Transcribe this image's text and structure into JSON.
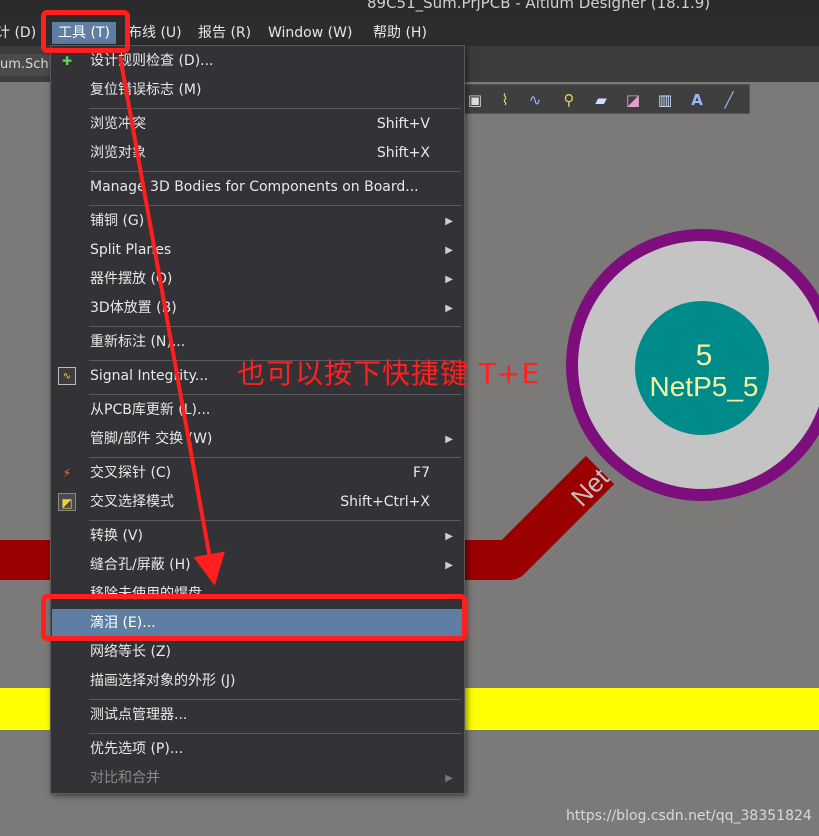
{
  "title_bar": {
    "title": "89C51_Sum.PrjPCB - Altium Designer (18.1.9)"
  },
  "menubar": {
    "items": [
      {
        "label": "计 (D)"
      },
      {
        "label": "工具 (T)"
      },
      {
        "label": "布线 (U)"
      },
      {
        "label": "报告 (R)"
      },
      {
        "label": "Window (W)"
      },
      {
        "label": "帮助 (H)"
      }
    ]
  },
  "doc_tab": {
    "label": "um.SchD"
  },
  "pad": {
    "number": "5",
    "net": "NetP5_5"
  },
  "trace_label": "Net",
  "annotation": {
    "text": "也可以按下快捷键 T+E"
  },
  "watermark": "https://blog.csdn.net/qq_38351824",
  "tools_menu": {
    "items": [
      {
        "label": "设计规则检查 (D)...",
        "shortcut": "",
        "submenu": false,
        "icon": "drc-icon"
      },
      {
        "label": "复位错误标志 (M)",
        "shortcut": "",
        "submenu": false
      },
      {
        "label": "浏览冲突",
        "shortcut": "Shift+V",
        "submenu": false
      },
      {
        "label": "浏览对象",
        "shortcut": "Shift+X",
        "submenu": false
      },
      {
        "label": "Manage 3D Bodies for Components on Board...",
        "shortcut": "",
        "submenu": false
      },
      {
        "label": "铺铜 (G)",
        "shortcut": "",
        "submenu": true
      },
      {
        "label": "Split Planes",
        "shortcut": "",
        "submenu": true
      },
      {
        "label": "器件摆放 (O)",
        "shortcut": "",
        "submenu": true
      },
      {
        "label": "3D体放置 (B)",
        "shortcut": "",
        "submenu": true
      },
      {
        "label": "重新标注 (N)...",
        "shortcut": "",
        "submenu": false
      },
      {
        "label": "Signal Integrity...",
        "shortcut": "",
        "submenu": false,
        "icon": "signal-integrity-icon"
      },
      {
        "label": "从PCB库更新 (L)...",
        "shortcut": "",
        "submenu": false
      },
      {
        "label": "管脚/部件 交换 (W)",
        "shortcut": "",
        "submenu": true
      },
      {
        "label": "交叉探针 (C)",
        "shortcut": "F7",
        "submenu": false,
        "icon": "cross-probe-icon"
      },
      {
        "label": "交叉选择模式",
        "shortcut": "Shift+Ctrl+X",
        "submenu": false,
        "icon": "cross-select-icon"
      },
      {
        "label": "转换 (V)",
        "shortcut": "",
        "submenu": true
      },
      {
        "label": "缝合孔/屏蔽 (H)",
        "shortcut": "",
        "submenu": true
      },
      {
        "label": "移除未使用的焊盘...",
        "shortcut": "",
        "submenu": false
      },
      {
        "label": "滴泪 (E)...",
        "shortcut": "",
        "submenu": false,
        "highlighted": true
      },
      {
        "label": "网络等长 (Z)",
        "shortcut": "",
        "submenu": false
      },
      {
        "label": "描画选择对象的外形 (J)",
        "shortcut": "",
        "submenu": false
      },
      {
        "label": "测试点管理器...",
        "shortcut": "",
        "submenu": false
      },
      {
        "label": "优先选项 (P)...",
        "shortcut": "",
        "submenu": false
      },
      {
        "label": "对比和合并",
        "shortcut": "",
        "submenu": true,
        "disabled": true
      }
    ]
  },
  "colors": {
    "highlight": "#5f7ea3",
    "annotation_red": "#ff1f1f",
    "pad_ring": "#7d0f7d",
    "pad_copper": "#008b8b",
    "trace": "#9b0000",
    "silkscreen": "#ffff00"
  }
}
